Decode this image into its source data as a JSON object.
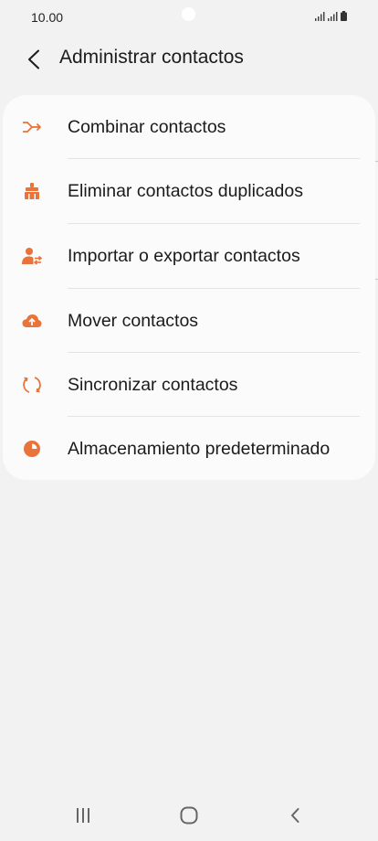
{
  "status_bar": {
    "time": "10.00",
    "icons": [
      "signal-icon",
      "signal-icon",
      "battery-icon"
    ]
  },
  "header": {
    "title": "Administrar contactos",
    "back_icon": "back-arrow-icon"
  },
  "menu": {
    "items": [
      {
        "label": "Combinar contactos",
        "icon": "merge-icon"
      },
      {
        "label": "Eliminar contactos duplicados",
        "icon": "brush-icon"
      },
      {
        "label": "Importar o exportar contactos",
        "icon": "import-export-icon"
      },
      {
        "label": "Mover contactos",
        "icon": "cloud-upload-icon"
      },
      {
        "label": "Sincronizar contactos",
        "icon": "sync-icon"
      },
      {
        "label": "Almacenamiento predeterminado",
        "icon": "storage-pie-icon"
      }
    ]
  },
  "nav_bar": {
    "buttons": [
      "recent-apps-icon",
      "home-icon",
      "back-icon"
    ]
  },
  "colors": {
    "accent": "#e8743b",
    "background": "#f2f2f2",
    "card": "#fbfbfb",
    "text": "#1b1b1b"
  }
}
